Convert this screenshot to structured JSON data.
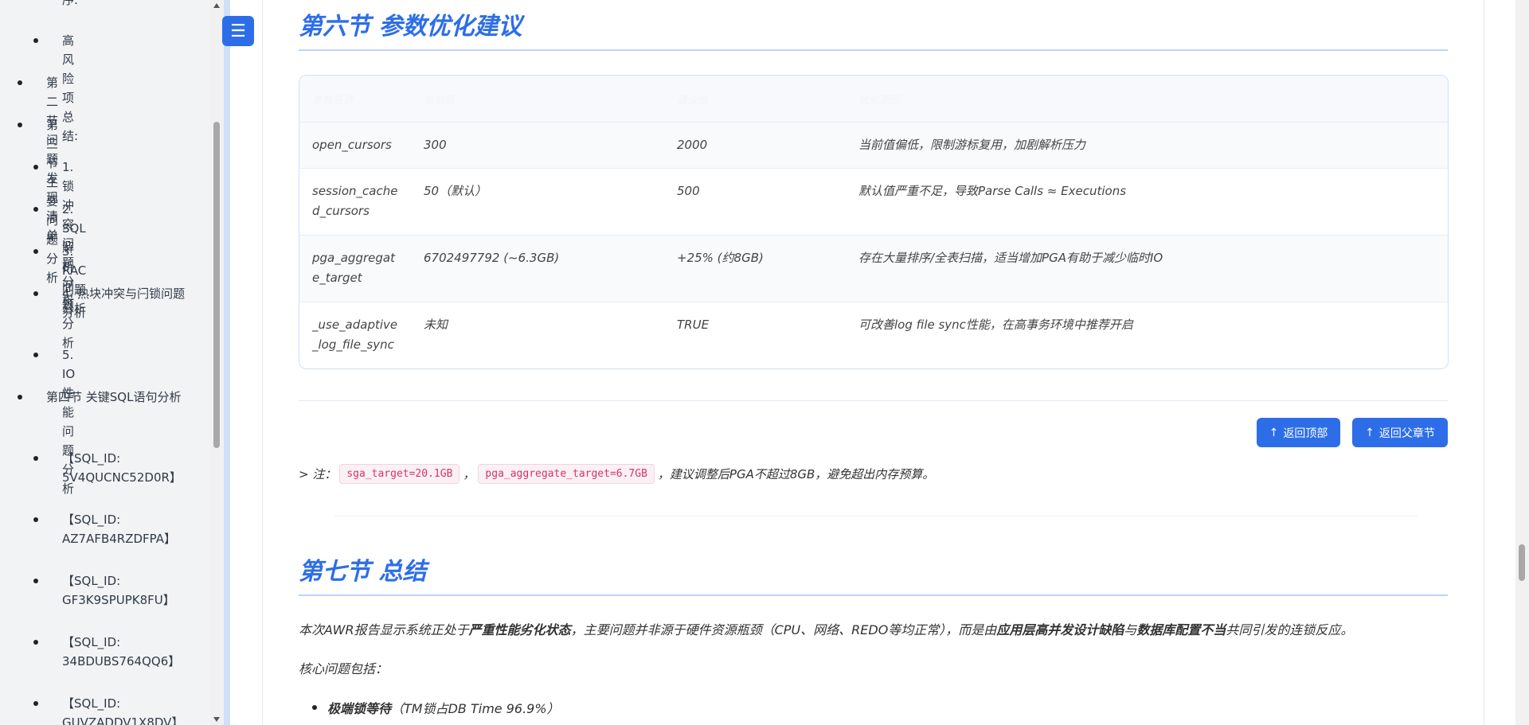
{
  "sidebar": {
    "items": [
      {
        "label": "序:",
        "level": 2
      },
      {
        "label": "高风险项总结:",
        "level": 2
      },
      {
        "label": "第二节 问题发现清单",
        "level": 1
      },
      {
        "label": "第三节 主要问题分析",
        "level": 1
      },
      {
        "label": "1. 锁冲突问题分析",
        "level": 2
      },
      {
        "label": "2. SQL解析问题分析",
        "level": 2
      },
      {
        "label": "3. RAC问题分析",
        "level": 2
      },
      {
        "label": "4. 热块冲突与闩锁问题分析",
        "level": 2
      },
      {
        "label": "5. IO性能问题分析",
        "level": 2
      },
      {
        "label": "第四节 关键SQL语句分析",
        "level": 1
      },
      {
        "label": "【SQL_ID: 5V4QUCNC52D0R】",
        "level": 2
      },
      {
        "label": "【SQL_ID: AZ7AFB4RZDFPA】",
        "level": 2
      },
      {
        "label": "【SQL_ID: GF3K9SPUPK8FU】",
        "level": 2
      },
      {
        "label": "【SQL_ID: 34BDUBS764QQ6】",
        "level": 2
      },
      {
        "label": "【SQL_ID: GUVZADDV1X8DV】",
        "level": 2
      }
    ]
  },
  "toolbar": {
    "menu_icon": "☰"
  },
  "section6": {
    "title": "第六节 参数优化建议",
    "table": {
      "headers": [
        "参数名称",
        "当前值",
        "建议值",
        "优化原因"
      ],
      "rows": [
        [
          "open_cursors",
          "300",
          "2000",
          "当前值偏低，限制游标复用，加剧解析压力"
        ],
        [
          "session_cached_cursors",
          "50（默认）",
          "500",
          "默认值严重不足，导致Parse Calls ≈ Executions"
        ],
        [
          "pga_aggregate_target",
          "6702497792 (~6.3GB)",
          "+25% (约8GB)",
          "存在大量排序/全表扫描，适当增加PGA有助于减少临时IO"
        ],
        [
          "_use_adaptive_log_file_sync",
          "未知",
          "TRUE",
          "可改善log file sync性能，在高事务环境中推荐开启"
        ]
      ]
    },
    "buttons": {
      "back_top": "返回顶部",
      "back_parent": "返回父章节"
    },
    "note": {
      "prefix": "> 注：",
      "code1": "sga_target=20.1GB",
      "sep": "，",
      "code2": "pga_aggregate_target=6.7GB",
      "suffix": "，建议调整后PGA不超过8GB，避免超出内存预算。"
    }
  },
  "section7": {
    "title": "第七节 总结",
    "summary": {
      "p1": "本次AWR报告显示系统正处于",
      "b1": "严重性能劣化状态",
      "p2": "，主要问题并非源于硬件资源瓶颈（CPU、网络、REDO等均正常），而是由",
      "b2": "应用层高并发设计缺陷",
      "p3": "与",
      "b3": "数据库配置不当",
      "p4": "共同引发的连锁反应。"
    },
    "core_label": "核心问题包括：",
    "bullets": [
      {
        "bold": "极端锁等待",
        "rest": "（TM锁占DB Time 96.9%）"
      }
    ]
  }
}
